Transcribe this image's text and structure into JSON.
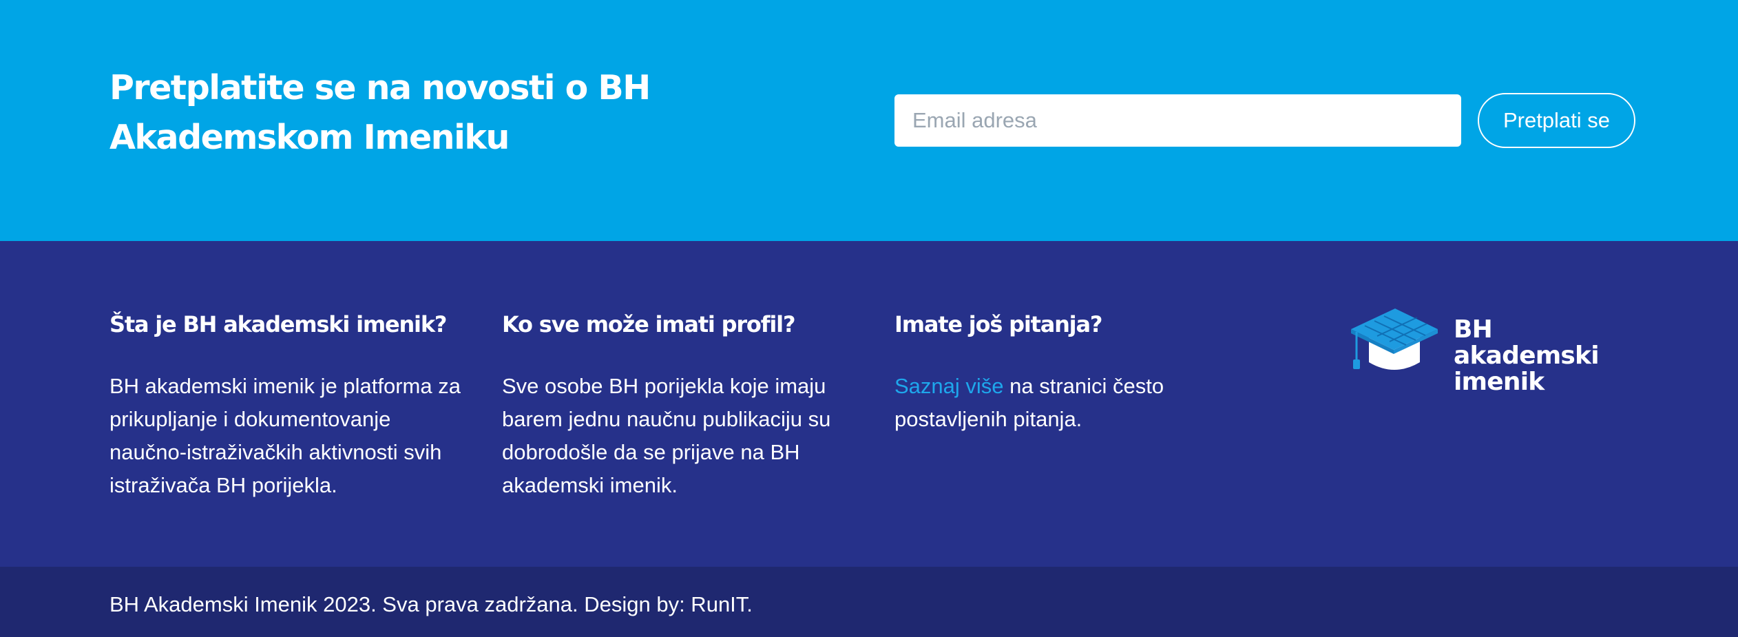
{
  "newsletter": {
    "title": "Pretplatite se na novosti o BH Akademskom Imeniku",
    "email_placeholder": "Email adresa",
    "email_value": "",
    "subscribe_label": "Pretplati se"
  },
  "footer": {
    "columns": [
      {
        "heading": "Šta je BH akademski imenik?",
        "text": "BH akademski imenik je platforma za prikupljanje i dokumentovanje naučno-istraživačkih aktivnosti svih istraživača BH porijekla."
      },
      {
        "heading": "Ko sve može imati profil?",
        "text": "Sve osobe BH porijekla koje imaju barem jednu naučnu publikaciju su dobrodošle da se prijave na BH akademski imenik."
      },
      {
        "heading": "Imate još pitanja?",
        "link_text": "Saznaj više",
        "text_after_link": " na stranici često postavljenih pitanja."
      }
    ],
    "logo": {
      "icon": "graduation-cap-icon",
      "line1": "BH akademski",
      "line2": "imenik"
    },
    "copyright": "BH Akademski Imenik 2023. Sva prava zadržana. Design by: RunIT."
  },
  "colors": {
    "newsletter_bg": "#00a5e6",
    "footer_bg": "#26318a",
    "bottom_bar_bg": "#1f2870",
    "link": "#1ea7ec"
  }
}
